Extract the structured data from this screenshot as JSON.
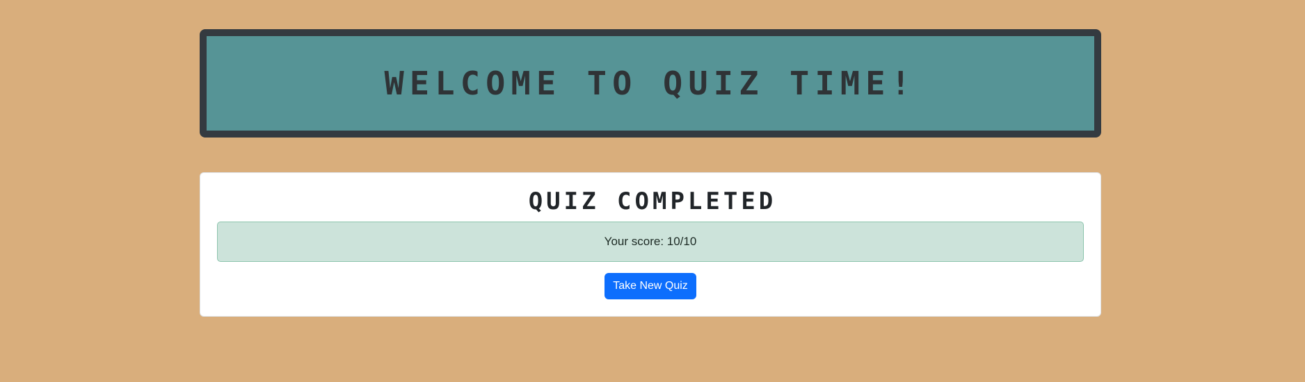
{
  "header": {
    "title": "WELCOME TO QUIZ TIME!"
  },
  "result": {
    "title": "QUIZ COMPLETED",
    "score_text": "Your score: 10/10",
    "new_quiz_label": "Take New Quiz"
  },
  "colors": {
    "page_background": "#d9ae7c",
    "header_background": "#569496",
    "header_border": "#343a40",
    "alert_background": "#cce3da",
    "button_primary": "#0d6efd"
  }
}
